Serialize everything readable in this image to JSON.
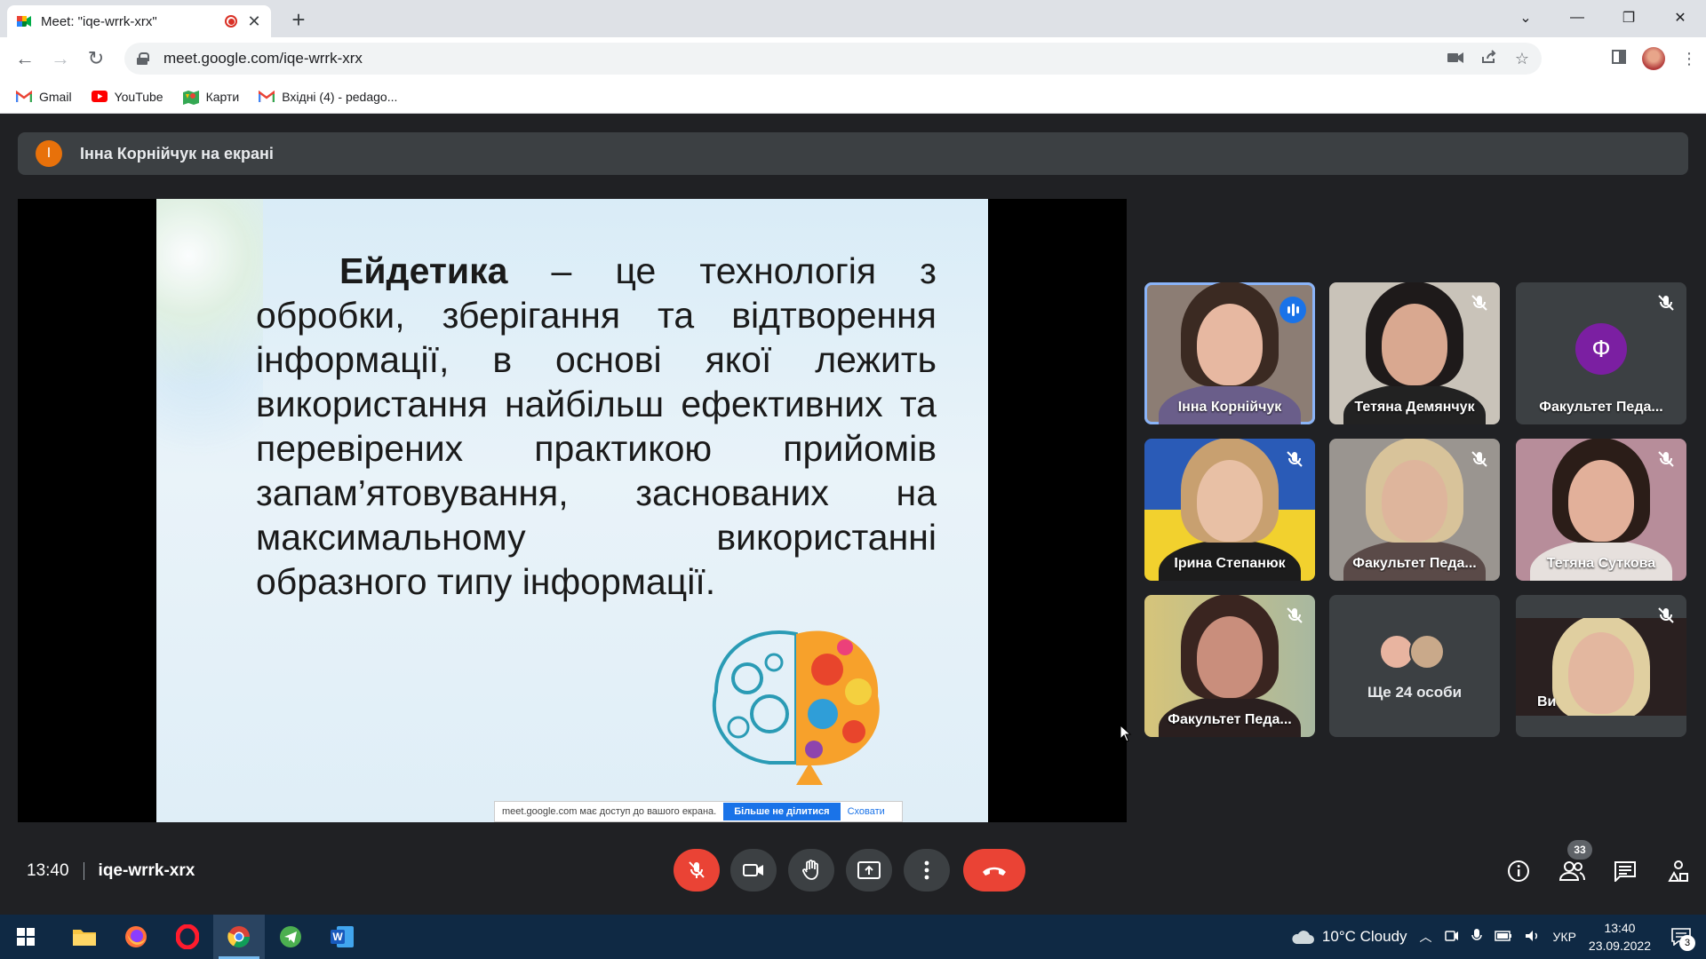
{
  "browser": {
    "tab_title": "Meet: \"iqe-wrrk-xrx\"",
    "url": "meet.google.com/iqe-wrrk-xrx",
    "bookmarks": [
      {
        "label": "Gmail",
        "icon": "gmail-icon"
      },
      {
        "label": "YouTube",
        "icon": "youtube-icon"
      },
      {
        "label": "Карти",
        "icon": "maps-icon"
      },
      {
        "label": "Вхідні (4) - pedago...",
        "icon": "gmail-icon"
      }
    ]
  },
  "meet": {
    "presenter_initial": "І",
    "presenter_banner": "Інна Корнійчук на екрані",
    "slide": {
      "term": "Ейдетика",
      "body": " – це технологія з обробки, зберігання та відтворення інформації, в основі якої лежить використання найбільш ефективних та перевірених практикою прийомів запам’ятовування, заснованих на максимальному використанні образного типу інформації."
    },
    "share_strip": {
      "message": "meet.google.com має доступ до вашого екрана.",
      "stop_label": "Більше не ділитися",
      "hide_label": "Сховати"
    },
    "participants": [
      {
        "name": "Інна Корнійчук",
        "state": "speaking"
      },
      {
        "name": "Тетяна Демянчук",
        "state": "muted"
      },
      {
        "name": "Факультет Педа...",
        "state": "muted",
        "avatar_letter": "Ф"
      },
      {
        "name": "Ірина Степанюк",
        "state": "muted"
      },
      {
        "name": "Факультет Педа...",
        "state": "muted"
      },
      {
        "name": "Тетяна Суткова",
        "state": "muted"
      },
      {
        "name": "Факультет Педа...",
        "state": "muted"
      },
      {
        "name": "Ще 24 особи",
        "state": "more"
      },
      {
        "name": "Ви",
        "state": "muted"
      }
    ],
    "time": "13:40",
    "meeting_code": "iqe-wrrk-xrx",
    "people_count": "33"
  },
  "taskbar": {
    "weather": "10°C  Cloudy",
    "language": "УКР",
    "time": "13:40",
    "date": "23.09.2022",
    "notifications": "3"
  },
  "colors": {
    "meet_bg": "#202124",
    "tile_bg": "#3c4043",
    "accent_blue": "#1a73e8",
    "hangup_red": "#ea4335",
    "taskbar": "#0f2944"
  }
}
